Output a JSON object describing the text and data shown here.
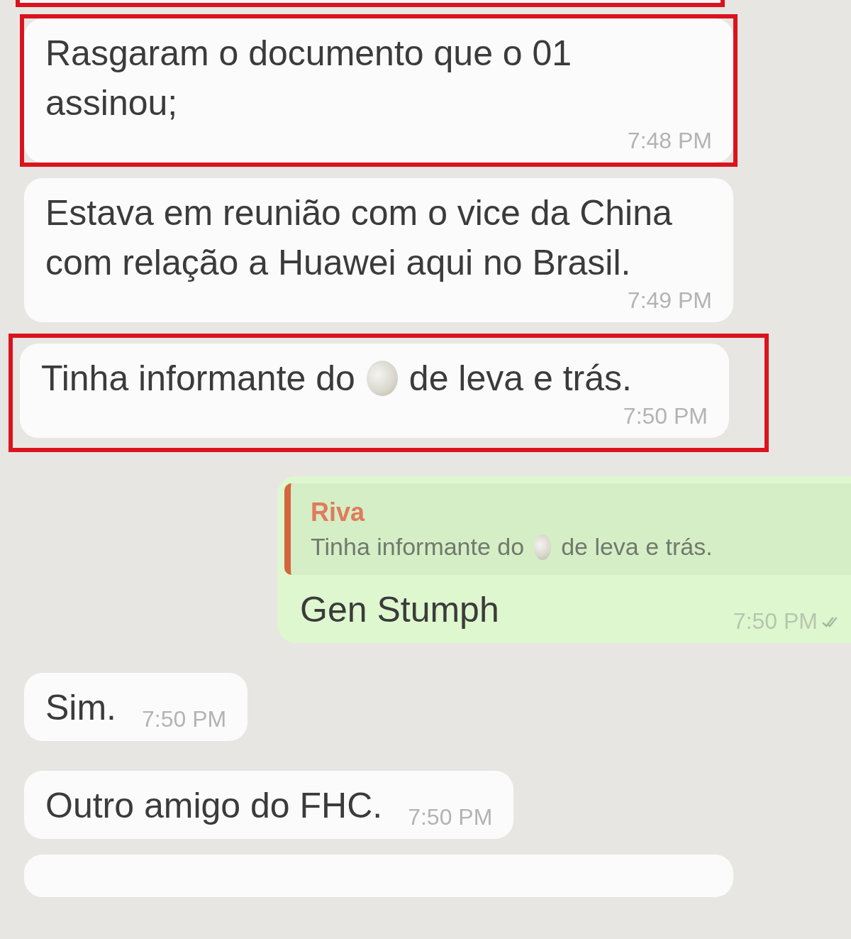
{
  "messages": [
    {
      "kind": "incoming",
      "highlighted": true,
      "parts": [
        {
          "kind": "text",
          "text": "Rasgaram o documento que o 01 assinou;"
        }
      ],
      "time": "7:48 PM"
    },
    {
      "kind": "incoming",
      "highlighted": false,
      "parts": [
        {
          "kind": "text",
          "text": "Estava em reunião com o vice da China com relação a Huawei aqui no Brasil."
        }
      ],
      "time": "7:49 PM"
    },
    {
      "kind": "incoming",
      "highlighted": true,
      "parts": [
        {
          "kind": "text",
          "text": "Tinha informante do"
        },
        {
          "kind": "emoji"
        },
        {
          "kind": "text",
          "text": "de leva e trás."
        }
      ],
      "time": "7:50 PM"
    },
    {
      "kind": "outgoing",
      "highlighted": false,
      "reply": {
        "author": "Riva",
        "parts": [
          {
            "kind": "text",
            "text": "Tinha informante do"
          },
          {
            "kind": "emoji"
          },
          {
            "kind": "text",
            "text": "de leva e trás."
          }
        ]
      },
      "parts": [
        {
          "kind": "text",
          "text": "Gen Stumph"
        }
      ],
      "time": "7:50 PM"
    },
    {
      "kind": "incoming",
      "highlighted": false,
      "parts": [
        {
          "kind": "text",
          "text": "Sim."
        }
      ],
      "time": "7:50 PM"
    },
    {
      "kind": "incoming",
      "highlighted": false,
      "parts": [
        {
          "kind": "text",
          "text": "Outro amigo do FHC."
        }
      ],
      "time": "7:50 PM"
    },
    {
      "kind": "partial",
      "highlighted": false
    }
  ]
}
